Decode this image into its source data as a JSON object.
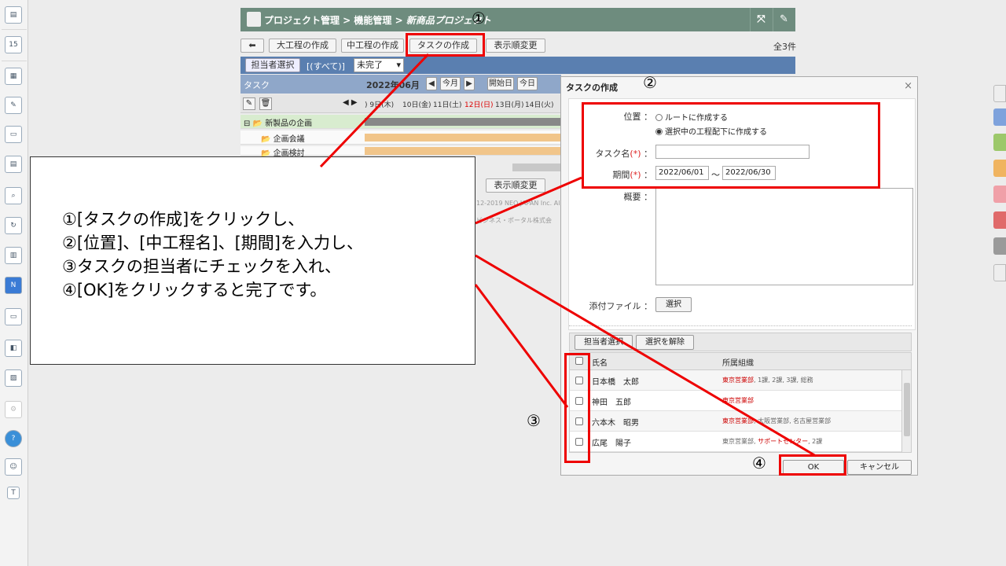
{
  "header": {
    "breadcrumb": "プロジェクト管理 > 機能管理 > ",
    "project": "新商品プロジェクト",
    "expand_icon": "expand-icon",
    "settings_icon": "wrench-icon"
  },
  "toolbar": {
    "back_icon": "back-arrow-icon",
    "buttons": [
      "大工程の作成",
      "中工程の作成",
      "タスクの作成",
      "表示順変更"
    ],
    "count": "全3件"
  },
  "filter": {
    "assignee_button": "担当者選択",
    "scope": "[(すべて)]",
    "status_select": "未完了"
  },
  "gantt": {
    "task_header": "タスク",
    "month": "2022年06月",
    "nav_buttons": [
      "◀",
      "今月",
      "▶",
      "開始日",
      "今日"
    ],
    "days": [
      ") 9日(木)",
      "10日(金)",
      "11日(土)",
      "12日(日)",
      "13日(月)",
      "14日(火)"
    ],
    "rows": [
      "新製品の企画",
      "企画会議",
      "企画検討"
    ],
    "bottom_button": "表示順変更",
    "copyright_1": "12-2019 NEO JAPAN Inc. All",
    "copyright_2": "ビジネス・ポータル株式会"
  },
  "callout": {
    "lines": [
      "①[タスクの作成]をクリックし、",
      "②[位置]、[中工程名]、[期間]を入力し、",
      "③タスクの担当者にチェックを入れ、",
      "④[OK]をクリックすると完了です。"
    ]
  },
  "dialog": {
    "title": "タスクの作成",
    "close": "×",
    "position_label": "位置 ：",
    "position_options": [
      "ルートに作成する",
      "選択中の工程配下に作成する"
    ],
    "task_name_label": "タスク名",
    "required_mark": "(*)",
    "colon": "：",
    "period_label": "期間",
    "start_date": "2022/06/01",
    "tilde": "～",
    "end_date": "2022/06/30",
    "summary_label": "概要 ：",
    "attach_label": "添付ファイル ：",
    "attach_button": "選択",
    "assignee_button": "担当者選択",
    "clear_button": "選択を解除",
    "col_name": "氏名",
    "col_org": "所属組織",
    "members": [
      {
        "name": "日本橋　太郎",
        "org_red": "東京営業部",
        "org_rest": ", 1課, 2課, 3課, 総務"
      },
      {
        "name": "神田　五郎",
        "org_red": "東京営業部",
        "org_rest": ""
      },
      {
        "name": "六本木　昭男",
        "org_red": "東京営業部",
        "org_rest": ", 大阪営業部, 名古屋営業部"
      },
      {
        "name": "広尾　陽子",
        "org_red": "",
        "org_rest": "東京営業部, ",
        "org_red2": "サポートセンター",
        "org_tail": ", 2課"
      }
    ],
    "ok_button": "OK",
    "cancel_button": "キャンセル"
  },
  "annotations": [
    "①",
    "②",
    "③",
    "④"
  ],
  "colors": {
    "annotation": "#e00000",
    "header": "#6e8c7e",
    "filter_bar": "#5a7fb0"
  }
}
